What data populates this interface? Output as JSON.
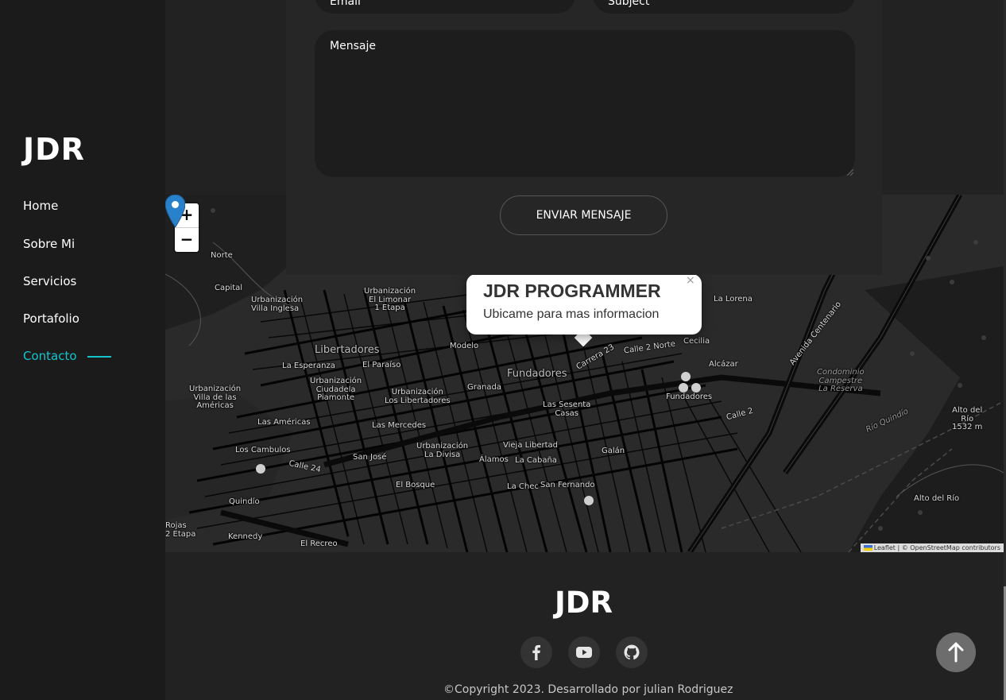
{
  "sidebar": {
    "logo": "JDR",
    "nav": [
      {
        "label": "Home"
      },
      {
        "label": "Sobre Mi"
      },
      {
        "label": "Servicios"
      },
      {
        "label": "Portafolio"
      },
      {
        "label": "Contacto",
        "active": true
      }
    ]
  },
  "form": {
    "email_label": "Email",
    "subject_label": "Subject",
    "message_label": "Mensaje",
    "submit_label": "ENVIAR MENSAJE"
  },
  "map": {
    "zoom_in": "+",
    "zoom_out": "−",
    "popup": {
      "title": "JDR PROGRAMMER",
      "subtitle": "Ubicame para mas informacion",
      "close": "×"
    },
    "attribution": "Leaflet | © OpenStreetMap contributors",
    "labels": {
      "norte": "Norte",
      "capital": "Capital",
      "villa_inglesa": "Urbanización\nVilla Inglesa",
      "limonar": "Urbanización\nEl Limonar\n1 Etapa",
      "libertadores": "Libertadores",
      "modelo": "Modelo",
      "la_esperanza": "La Esperanza",
      "el_paraiso": "El Paraíso",
      "fundadores": "Fundadores",
      "villa_americas": "Urbanización\nVilla de las\nAméricas",
      "ciudadela_piamonte": "Urbanización\nCiudadela\nPiamonte",
      "urb_libertadores": "Urbanización\nLos Libertadores",
      "granada": "Granada",
      "sesenta_casas": "Las Sesenta\nCasas",
      "las_americas": "Las Américas",
      "las_mercedes": "Las Mercedes",
      "los_cambulos": "Los Cambulos",
      "la_divisa": "Urbanización\nLa Divisa",
      "vieja_libertad": "Vieja Libertad",
      "san_jose": "San José",
      "alamos": "Álamos",
      "la_cabana": "La Cabaña",
      "el_bosque": "El Bosque",
      "la_chec": "La Chec",
      "san_fernando": "San Fernando",
      "quindio": "Quindío",
      "kennedy": "Kennedy",
      "el_recreo": "El Recreo",
      "rojas": "Rojas\n2 Etapa",
      "galan": "Galán",
      "cecilia": "Cecilia",
      "alcazar": "Alcázar",
      "fundadores_2": "Fundadores",
      "la_lorena": "La Lorena",
      "condominio": "Condominio\nCampestre\nLa Reserva",
      "alto_rio_1": "Alto del\nRío\n1532 m",
      "alto_rio_2": "Alto del Río",
      "rio_quindio": "Río Quindío",
      "av_centenario": "Avenida Centenario",
      "calle_2": "Calle 2",
      "carrera_23": "Carrera 23",
      "calle_24": "Calle 24",
      "calle_2_norte": "Calle 2 Norte"
    }
  },
  "footer": {
    "logo": "JDR",
    "socials": [
      {
        "icon": "facebook-icon"
      },
      {
        "icon": "youtube-icon"
      },
      {
        "icon": "github-icon"
      }
    ],
    "copyright": "©Copyright 2023. Desarrollado por julian Rodriguez"
  },
  "colors": {
    "accent": "#14c6cc",
    "background": "#222222",
    "sidebar": "#1b1b1b",
    "marker": "#2a81cb"
  }
}
